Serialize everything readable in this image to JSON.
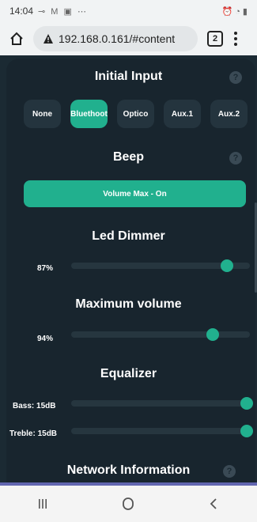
{
  "status_bar": {
    "time": "14:04",
    "glyphs": "⊸ M ▣ ⋯",
    "right_glyphs": "⏰ ◔ ▮"
  },
  "browser": {
    "url": "192.168.0.161/#content",
    "tab_count": "2"
  },
  "sections": {
    "initial_input": {
      "title": "Initial Input",
      "options": [
        "None",
        "Bluethoot",
        "Optico",
        "Aux.1",
        "Aux.2"
      ],
      "selected": "Bluethoot"
    },
    "beep": {
      "title": "Beep",
      "button_label": "Volume Max - On"
    },
    "led_dimmer": {
      "title": "Led Dimmer",
      "value_label": "87%",
      "value": 0.87
    },
    "max_volume": {
      "title": "Maximum volume",
      "value_label": "94%",
      "value": 0.94
    },
    "equalizer": {
      "title": "Equalizer",
      "bass_label": "Bass: 15dB",
      "treble_label": "Treble: 15dB",
      "bass_value": 1.0,
      "treble_value": 1.0
    },
    "network": {
      "title": "Network Information"
    }
  },
  "help_glyph": "?",
  "colors": {
    "accent": "#21b08e",
    "background": "#1b2a33",
    "button": "#24343e",
    "bottom_strip": "#6266b0"
  },
  "icons": [
    "home-icon",
    "warning-icon",
    "tabs-icon",
    "menu-icon",
    "help-icon",
    "recents-icon",
    "home-nav-icon",
    "back-icon"
  ]
}
